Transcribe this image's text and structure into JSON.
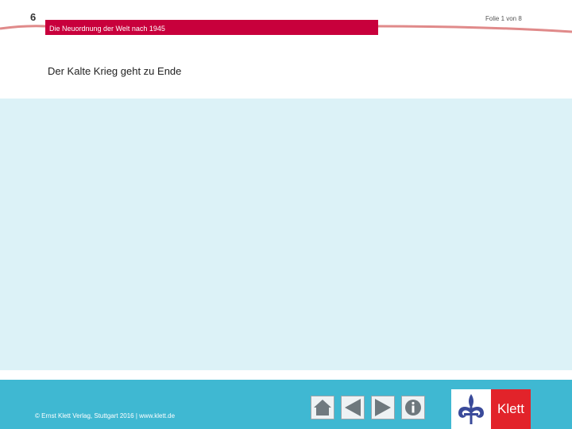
{
  "header": {
    "chapter_number": "6",
    "chapter_title": "Die Neuordnung der Welt nach 1945",
    "slide_counter": "Folie 1 von 8",
    "accent_color": "#c8003c"
  },
  "main": {
    "title": "Der Kalte Krieg geht zu Ende",
    "background_color": "#dcf2f7"
  },
  "footer": {
    "copyright": "© Ernst Klett Verlag, Stuttgart 2016 | www.klett.de",
    "background_color": "#3fb8d2",
    "nav": [
      {
        "icon": "home-icon"
      },
      {
        "icon": "arrow-left-icon"
      },
      {
        "icon": "arrow-right-icon"
      },
      {
        "icon": "info-icon"
      }
    ],
    "logo": {
      "text": "Klett",
      "brand_color": "#e2232a"
    }
  }
}
